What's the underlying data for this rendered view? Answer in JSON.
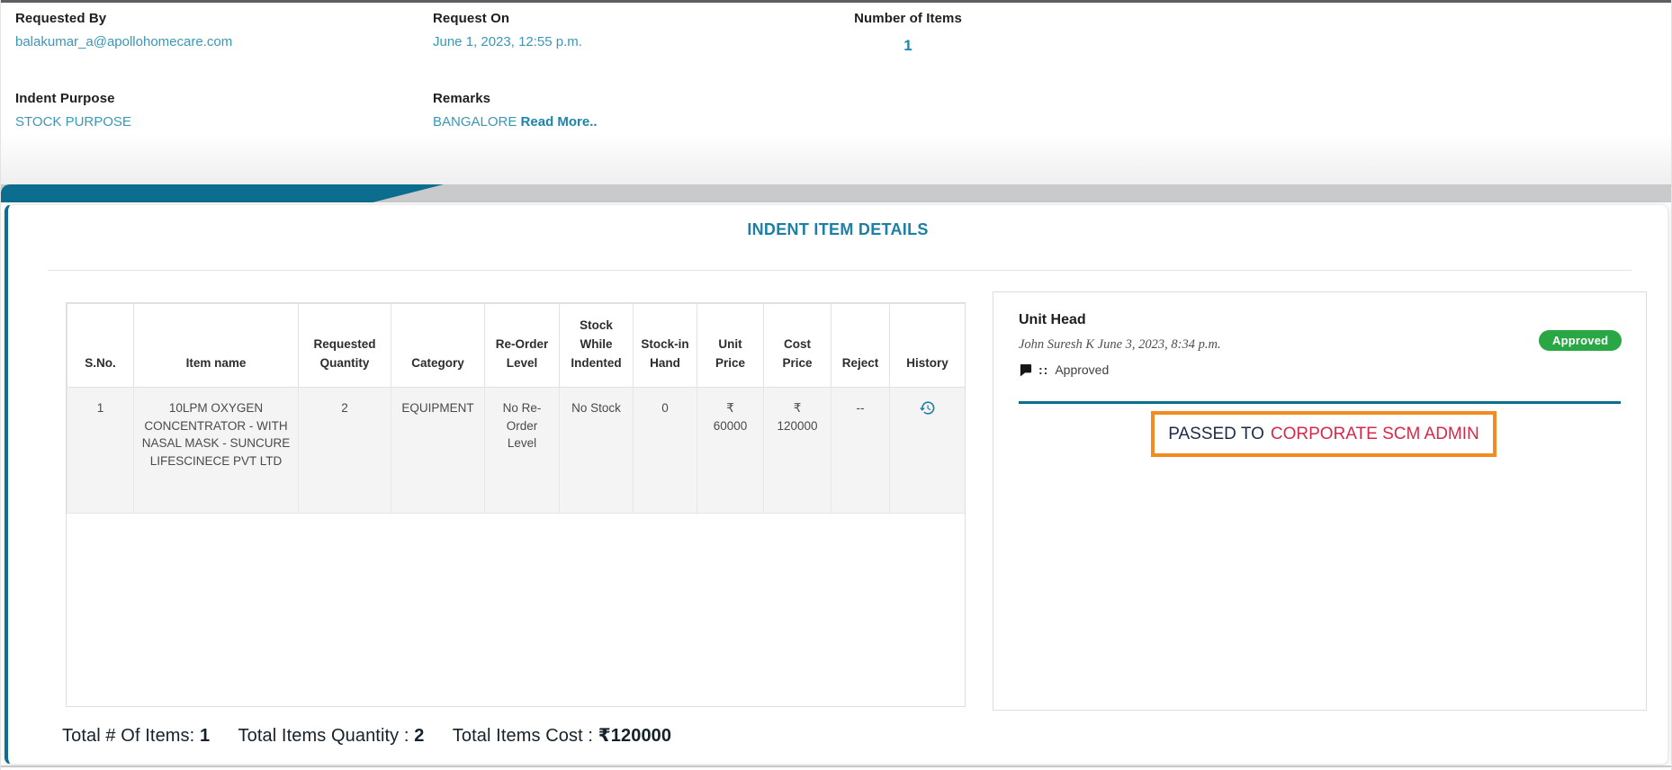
{
  "header_fields": {
    "requested_by": {
      "label": "Requested By",
      "value": "balakumar_a@apollohomecare.com"
    },
    "request_on": {
      "label": "Request On",
      "value": "June 1, 2023, 12:55 p.m."
    },
    "number_of_items": {
      "label": "Number of Items",
      "value": "1"
    },
    "indent_purpose": {
      "label": "Indent Purpose",
      "value": "STOCK PURPOSE"
    },
    "remarks": {
      "label": "Remarks",
      "value": "BANGALORE",
      "read_more": "Read More.."
    }
  },
  "section": {
    "title": "INDENT ITEM DETAILS"
  },
  "table": {
    "columns": [
      "S.No.",
      "Item name",
      "Requested Quantity",
      "Category",
      "Re-Order Level",
      "Stock While Indented",
      "Stock-in Hand",
      "Unit Price",
      "Cost Price",
      "Reject",
      "History"
    ],
    "rows": [
      {
        "sno": "1",
        "item_name": "10LPM OXYGEN CONCENTRATOR - WITH NASAL MASK - SUNCURE LIFESCINECE PVT LTD",
        "requested_quantity": "2",
        "category": "EQUIPMENT",
        "reorder_level": "No Re-Order Level",
        "stock_while_indented": "No Stock",
        "stock_in_hand": "0",
        "unit_price_currency": "₹",
        "unit_price": "60000",
        "cost_price_currency": "₹",
        "cost_price": "120000",
        "reject": "--",
        "history_icon": "history-restore-icon"
      }
    ]
  },
  "approval": {
    "role": "Unit Head",
    "byline": "John Suresh K June 3, 2023, 8:34 p.m.",
    "badge": "Approved",
    "comment_colons": "::",
    "comment": "Approved",
    "passed_to_label": "PASSED TO",
    "passed_to_value": "CORPORATE SCM ADMIN"
  },
  "totals": {
    "items_label": "Total # Of Items:",
    "items_value": "1",
    "quantity_label": "Total Items Quantity :",
    "quantity_value": "2",
    "cost_label": "Total Items Cost :",
    "cost_currency": "₹",
    "cost_value": "120000"
  },
  "colors": {
    "accent_teal_dark": "#0d6d8e",
    "heading_teal": "#1c7fa6",
    "link_teal": "#3a97b6",
    "badge_green": "#2aa745",
    "passed_border_orange": "#f28b20",
    "passed_value_red": "#d9274a",
    "passed_label_navy": "#1e2b47",
    "band_gray": "#c9cacb",
    "row_gray": "#f4f4f4"
  }
}
